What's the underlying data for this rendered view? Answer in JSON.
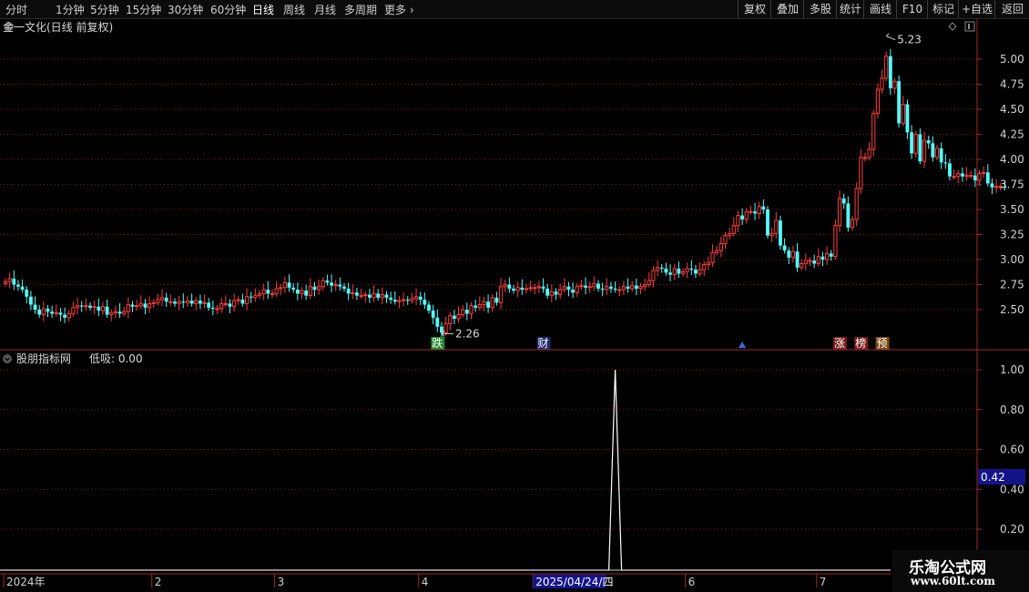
{
  "toolbar": {
    "periods": [
      "分时",
      "1分钟",
      "5分钟",
      "15分钟",
      "30分钟",
      "60分钟",
      "日线",
      "周线",
      "月线",
      "多周期",
      "更多"
    ],
    "active_period": "日线",
    "right_buttons": [
      "复权",
      "叠加",
      "多股",
      "统计",
      "画线",
      "F10",
      "标记",
      "+自选",
      "返回"
    ]
  },
  "main_panel": {
    "title": "金一文化(日线 前复权)",
    "high_label": "5.23",
    "low_label": "2.26",
    "price_ticks": [
      "5.00",
      "4.75",
      "4.50",
      "4.25",
      "4.00",
      "3.75",
      "3.50",
      "3.25",
      "3.00",
      "2.75",
      "2.50"
    ],
    "markers": [
      {
        "text": "跌",
        "color": "#1f8a2a",
        "date_index": 102
      },
      {
        "text": "财",
        "color": "#1a2a6a",
        "date_index": 127
      },
      {
        "text": "▲",
        "color": "#3a6bd0",
        "date_index": 174
      },
      {
        "text": "涨",
        "color": "#7a1a1a",
        "date_index": 197
      },
      {
        "text": "榜",
        "color": "#7a1a1a",
        "date_index": 202
      },
      {
        "text": "预",
        "color": "#7a4a10",
        "date_index": 207
      }
    ]
  },
  "sub_panel": {
    "title": "股朋指标网",
    "value_label": "低吸: 0.00",
    "ticks": [
      "1.00",
      "0.80",
      "0.60",
      "0.40",
      "0.20"
    ],
    "cursor_value": "0.42",
    "spike": {
      "date_index": 144,
      "value": 1.0
    }
  },
  "date_axis": {
    "labels": [
      {
        "text": "2024年",
        "date_index": 0
      },
      {
        "text": "2",
        "date_index": 35
      },
      {
        "text": "3",
        "date_index": 64
      },
      {
        "text": "4",
        "date_index": 98
      },
      {
        "text": "2025/04/24/四",
        "date_index": 125,
        "highlight": true
      },
      {
        "text": "6",
        "date_index": 161
      },
      {
        "text": "7",
        "date_index": 192
      }
    ]
  },
  "watermark": {
    "cn": "乐淘公式网",
    "url": "www.60lt.com"
  },
  "colors": {
    "up": "#ff3c3c",
    "down": "#54ffff",
    "grid": "#7a1a1a",
    "axis": "#a0282a",
    "line": "#ffffff"
  },
  "chart_data": {
    "type": "candlestick",
    "title": "金一文化(日线 前复权)",
    "ylim": [
      2.26,
      5.23
    ],
    "y_ticks": [
      2.5,
      2.75,
      3.0,
      3.25,
      3.5,
      3.75,
      4.0,
      4.25,
      4.5,
      4.75,
      5.0
    ],
    "high": 5.23,
    "low": 2.26,
    "closes": [
      2.78,
      2.81,
      2.75,
      2.73,
      2.7,
      2.63,
      2.55,
      2.5,
      2.45,
      2.51,
      2.48,
      2.46,
      2.47,
      2.45,
      2.42,
      2.46,
      2.52,
      2.54,
      2.53,
      2.54,
      2.52,
      2.53,
      2.49,
      2.53,
      2.45,
      2.47,
      2.48,
      2.46,
      2.48,
      2.55,
      2.53,
      2.54,
      2.56,
      2.52,
      2.56,
      2.57,
      2.6,
      2.62,
      2.58,
      2.58,
      2.56,
      2.58,
      2.57,
      2.59,
      2.56,
      2.59,
      2.56,
      2.57,
      2.52,
      2.51,
      2.51,
      2.56,
      2.56,
      2.53,
      2.59,
      2.6,
      2.56,
      2.63,
      2.62,
      2.64,
      2.66,
      2.7,
      2.66,
      2.66,
      2.71,
      2.72,
      2.77,
      2.72,
      2.7,
      2.66,
      2.69,
      2.64,
      2.73,
      2.7,
      2.73,
      2.79,
      2.77,
      2.74,
      2.75,
      2.73,
      2.71,
      2.66,
      2.67,
      2.64,
      2.64,
      2.65,
      2.62,
      2.66,
      2.62,
      2.65,
      2.62,
      2.6,
      2.58,
      2.59,
      2.6,
      2.59,
      2.61,
      2.63,
      2.6,
      2.55,
      2.49,
      2.42,
      2.33,
      2.27,
      2.36,
      2.44,
      2.41,
      2.45,
      2.5,
      2.46,
      2.54,
      2.52,
      2.55,
      2.58,
      2.52,
      2.62,
      2.57,
      2.73,
      2.75,
      2.71,
      2.69,
      2.72,
      2.7,
      2.71,
      2.72,
      2.72,
      2.73,
      2.71,
      2.64,
      2.68,
      2.65,
      2.7,
      2.73,
      2.7,
      2.67,
      2.73,
      2.74,
      2.72,
      2.73,
      2.76,
      2.71,
      2.7,
      2.73,
      2.71,
      2.7,
      2.7,
      2.73,
      2.71,
      2.74,
      2.71,
      2.73,
      2.75,
      2.79,
      2.89,
      2.92,
      2.91,
      2.87,
      2.85,
      2.91,
      2.86,
      2.88,
      2.91,
      2.9,
      2.86,
      2.9,
      2.95,
      2.97,
      3.07,
      3.09,
      3.16,
      3.24,
      3.26,
      3.34,
      3.44,
      3.4,
      3.48,
      3.48,
      3.46,
      3.53,
      3.5,
      3.24,
      3.26,
      3.39,
      3.14,
      3.09,
      3.02,
      3.08,
      2.92,
      2.96,
      2.99,
      2.99,
      2.96,
      3.03,
      3.0,
      3.06,
      3.03,
      3.34,
      3.61,
      3.56,
      3.32,
      3.4,
      3.71,
      4.02,
      4.02,
      4.1,
      4.46,
      4.7,
      4.81,
      5.03,
      4.71,
      4.78,
      4.36,
      4.55,
      4.27,
      4.06,
      4.25,
      3.98,
      4.19,
      4.16,
      4.02,
      4.11,
      3.97,
      3.96,
      3.83,
      3.83,
      3.86,
      3.83,
      3.84,
      3.84,
      3.79,
      3.86,
      3.87,
      3.76,
      3.72,
      3.73,
      3.73,
      3.72
    ]
  }
}
